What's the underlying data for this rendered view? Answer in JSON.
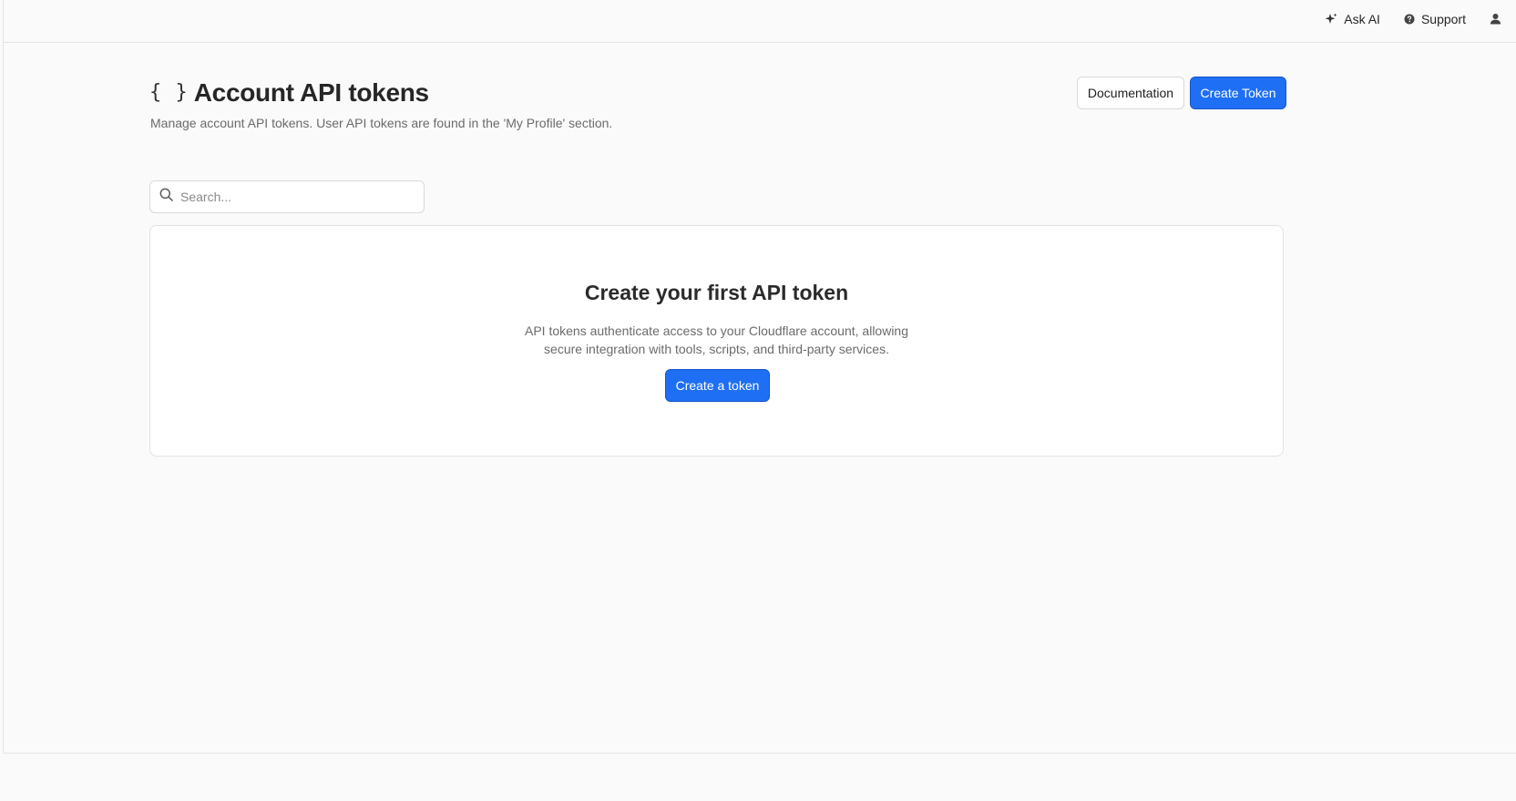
{
  "topbar": {
    "ask_ai_label": "Ask AI",
    "support_label": "Support",
    "icons": [
      "sparkle-icon",
      "help-icon",
      "user-icon"
    ]
  },
  "header": {
    "title_icon": "{ }",
    "title": "Account API tokens",
    "subtitle": "Manage account API tokens. User API tokens are found in the 'My Profile' section.",
    "documentation_label": "Documentation",
    "create_token_label": "Create Token"
  },
  "search": {
    "placeholder": "Search...",
    "value": ""
  },
  "empty_state": {
    "title": "Create your first API token",
    "description": "API tokens authenticate access to your Cloudflare account, allowing secure integration with tools, scripts, and third-party services.",
    "cta_label": "Create a token"
  },
  "colors": {
    "primary": "#1f6ff5",
    "background": "#fafafa",
    "border": "#e2e2e2"
  }
}
